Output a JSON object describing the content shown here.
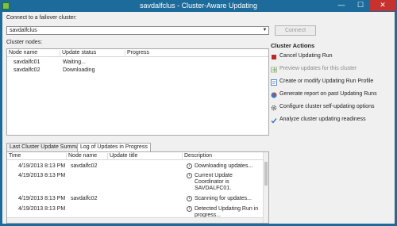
{
  "window": {
    "title": "savdalfclus - Cluster-Aware Updating",
    "min_glyph": "—",
    "max_glyph": "☐",
    "close_glyph": "✕"
  },
  "connect": {
    "label": "Connect to a failover cluster:",
    "value": "savdalfclus",
    "button": "Connect"
  },
  "nodes": {
    "label": "Cluster nodes:",
    "columns": [
      "Node name",
      "Update status",
      "Progress"
    ],
    "rows": [
      {
        "name": "savdalfc01",
        "status": "Waiting...",
        "progress": ""
      },
      {
        "name": "savdalfc02",
        "status": "Downloading",
        "progress": ""
      }
    ]
  },
  "tabs": [
    "Last Cluster Update Summary",
    "Log of Updates in Progress"
  ],
  "log": {
    "columns": [
      "Time",
      "Node name",
      "Update title",
      "Description"
    ],
    "rows": [
      {
        "time": "4/19/2013 8:13 PM",
        "node": "savdalfc02",
        "title": "",
        "desc": [
          "Downloading updates..."
        ]
      },
      {
        "time": "4/19/2013 8:13 PM",
        "node": "",
        "title": "",
        "desc": [
          "Current Update",
          "Coordinator is",
          "SAVDALFC01."
        ]
      },
      {
        "time": "4/19/2013 8:13 PM",
        "node": "savdalfc02",
        "title": "",
        "desc": [
          "Scanning for updates..."
        ]
      },
      {
        "time": "4/19/2013 8:13 PM",
        "node": "",
        "title": "",
        "desc": [
          "Detected Updating Run in",
          "progress..."
        ]
      }
    ]
  },
  "actions": {
    "title": "Cluster Actions",
    "items": [
      {
        "label": "Cancel Updating Run",
        "icon": "stop-icon",
        "color": "#c0262b",
        "enabled": true
      },
      {
        "label": "Preview updates for this cluster",
        "icon": "preview-icon",
        "color": "#5b9a2f",
        "enabled": false
      },
      {
        "label": "Create or modify Updating Run Profile",
        "icon": "profile-icon",
        "color": "#3a6fb0",
        "enabled": true
      },
      {
        "label": "Generate report on past Updating Runs",
        "icon": "report-icon",
        "color": "#d0412b",
        "enabled": true
      },
      {
        "label": "Configure cluster self-updating options",
        "icon": "gear-icon",
        "color": "#555555",
        "enabled": true
      },
      {
        "label": "Analyze cluster updating readiness",
        "icon": "checkmark-icon",
        "color": "#2b6cc4",
        "enabled": true
      }
    ]
  },
  "colors": {
    "titlebar": "#1d6b9a",
    "close": "#c7322f"
  }
}
